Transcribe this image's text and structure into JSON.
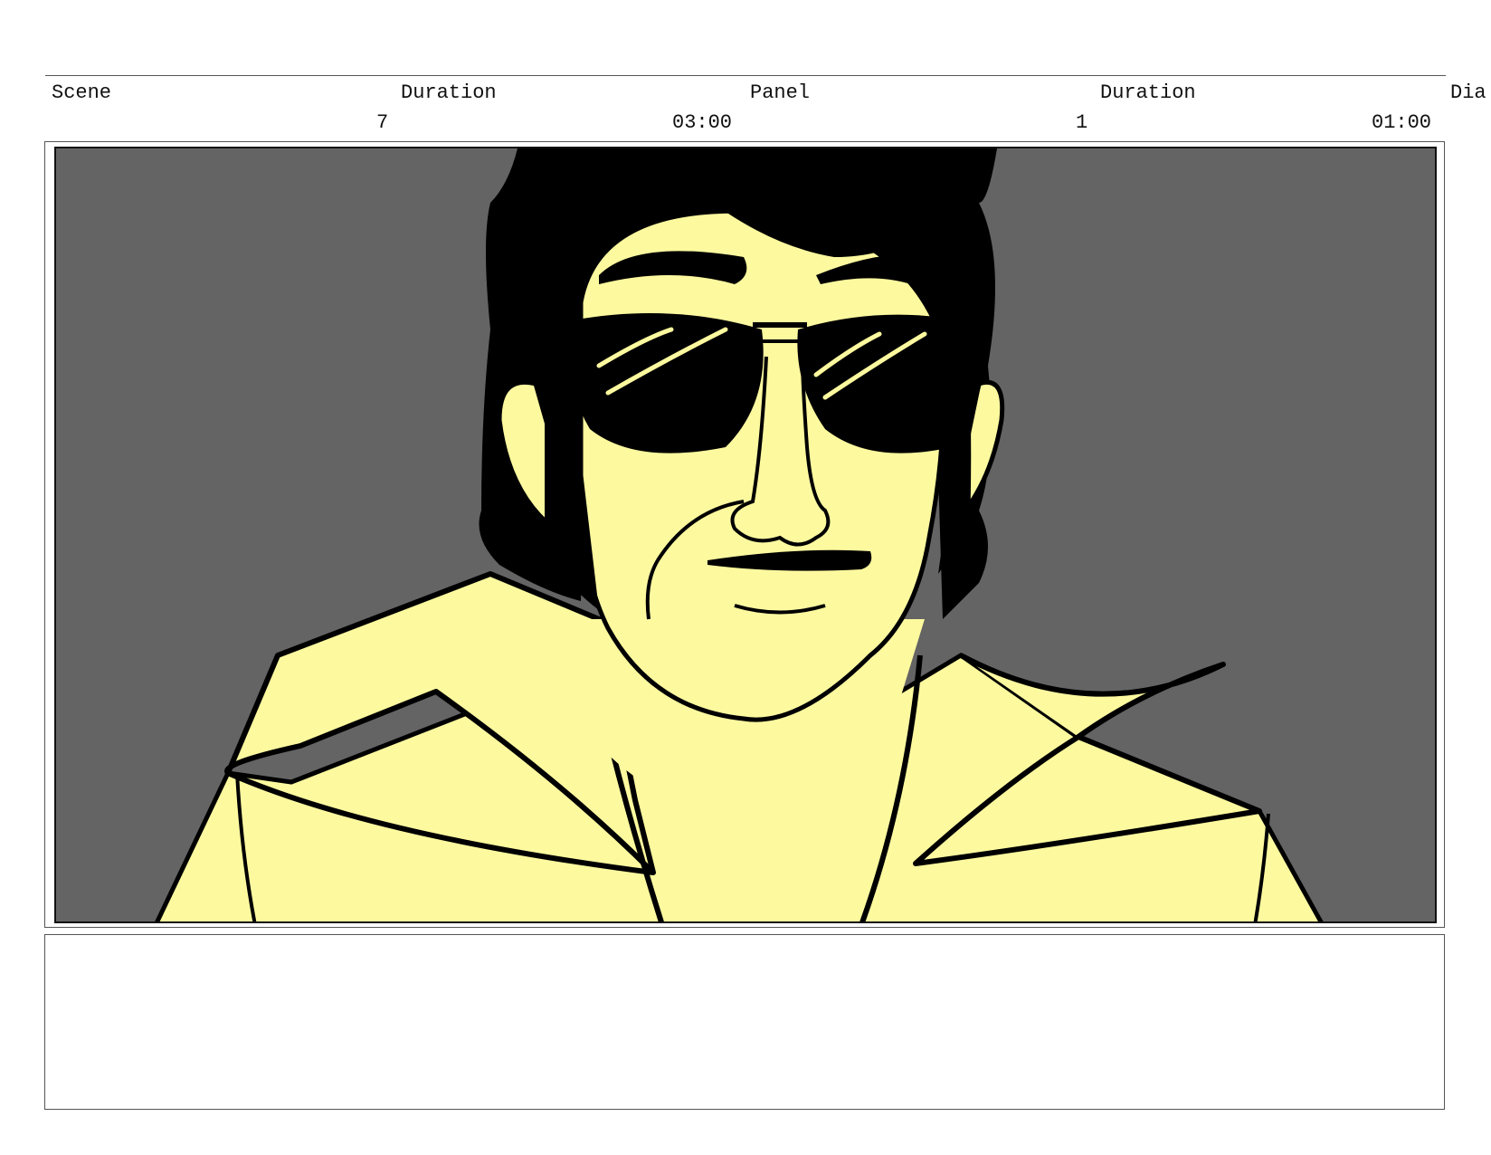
{
  "header": {
    "scene_label": "Scene",
    "scene_duration_label": "Duration",
    "panel_label": "Panel",
    "panel_duration_label": "Duration",
    "dialogue_label": "Dia"
  },
  "values": {
    "scene": "7",
    "scene_duration": "03:00",
    "panel": "1",
    "panel_duration": "01:00"
  },
  "panel_image": {
    "subject": "character-with-sunglasses-and-wide-collar",
    "colors": {
      "background": "#646464",
      "skin": "#fdf99f",
      "jacket": "#fdf99f",
      "hair": "#000000",
      "lines": "#000000"
    }
  },
  "notes": {
    "text": ""
  }
}
